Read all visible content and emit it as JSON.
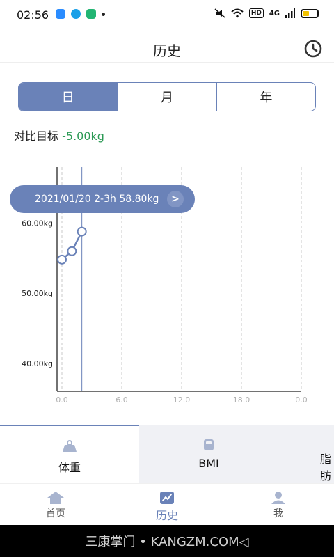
{
  "status_bar": {
    "time": "02:56",
    "network": "4G",
    "hd": "HD"
  },
  "header": {
    "title": "历史"
  },
  "period_tabs": [
    "日",
    "月",
    "年"
  ],
  "compare": {
    "label": "对比目标",
    "value": "-5.00kg"
  },
  "tooltip": {
    "text": "2021/01/20 2-3h 58.80kg"
  },
  "colors": {
    "accent": "#6a82b8",
    "green": "#2c9a55"
  },
  "chart_data": {
    "type": "line",
    "ylabels": [
      "60.00kg",
      "50.00kg",
      "40.00kg"
    ],
    "yticks": [
      60,
      50,
      40
    ],
    "xticks": [
      "0.0",
      "6.0",
      "12.0",
      "18.0",
      "0.0"
    ],
    "xtick_values": [
      0,
      6,
      12,
      18,
      24
    ],
    "xlim": [
      0,
      24
    ],
    "ylim": [
      36,
      68
    ],
    "series": [
      {
        "x": [
          0,
          1,
          2
        ],
        "values": [
          54.8,
          56.0,
          58.8
        ]
      }
    ]
  },
  "metrics": [
    {
      "label": "体重",
      "icon": "weight-icon"
    },
    {
      "label": "BMI",
      "icon": "bmi-icon"
    },
    {
      "label": "脂肪",
      "icon": "fat-icon"
    }
  ],
  "bottom_nav": [
    {
      "label": "首页",
      "icon": "home-icon"
    },
    {
      "label": "历史",
      "icon": "chart-icon"
    },
    {
      "label": "我",
      "icon": "user-icon"
    }
  ],
  "watermark": "三康掌门 • KANGZM.COM◁"
}
